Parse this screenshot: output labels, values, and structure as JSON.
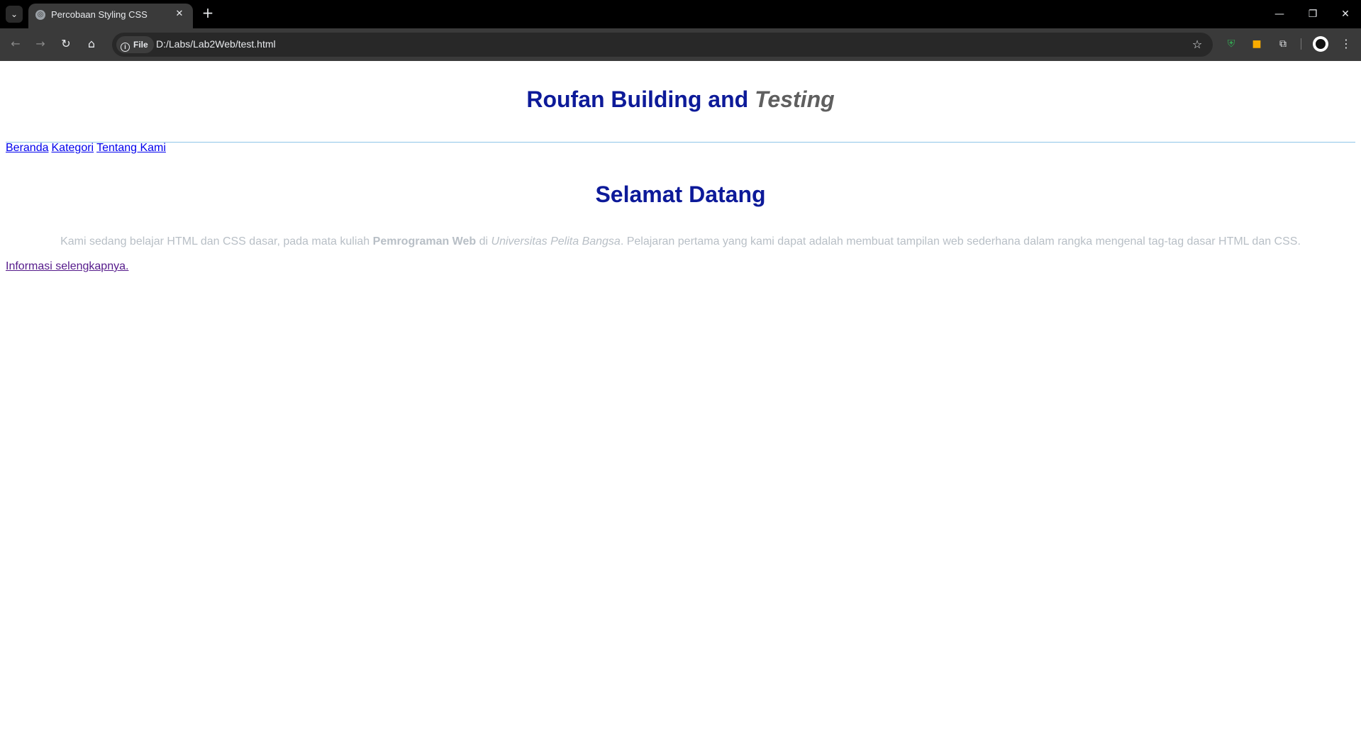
{
  "browser": {
    "tab_title": "Percobaan Styling CSS",
    "new_tab_label": "+",
    "chip_label": "File",
    "url": "D:/Labs/Lab2Web/test.html"
  },
  "page": {
    "title_main": "Roufan Building and",
    "title_em": "Testing",
    "nav": [
      "Beranda",
      "Kategori",
      "Tentang Kami"
    ],
    "heading": "Selamat Datang",
    "paragraph": {
      "part1": "Kami sedang belajar HTML dan CSS dasar, pada mata kuliah ",
      "bold": "Pemrograman Web",
      "part2": " di ",
      "italic": "Universitas Pelita Bangsa",
      "part3": ". Pelajaran pertama yang kami dapat adalah membuat tampilan web sederhana dalam rangka mengenal tag-tag dasar HTML dan CSS."
    },
    "more_link": "Informasi selengkapnya."
  },
  "colors": {
    "heading": "#0d1a99",
    "title_em": "#5f5f5f",
    "paragraph": "#b8bfc6",
    "link": "#0000ee",
    "visited_link": "#551a8b",
    "rule": "#8fc5e8"
  }
}
